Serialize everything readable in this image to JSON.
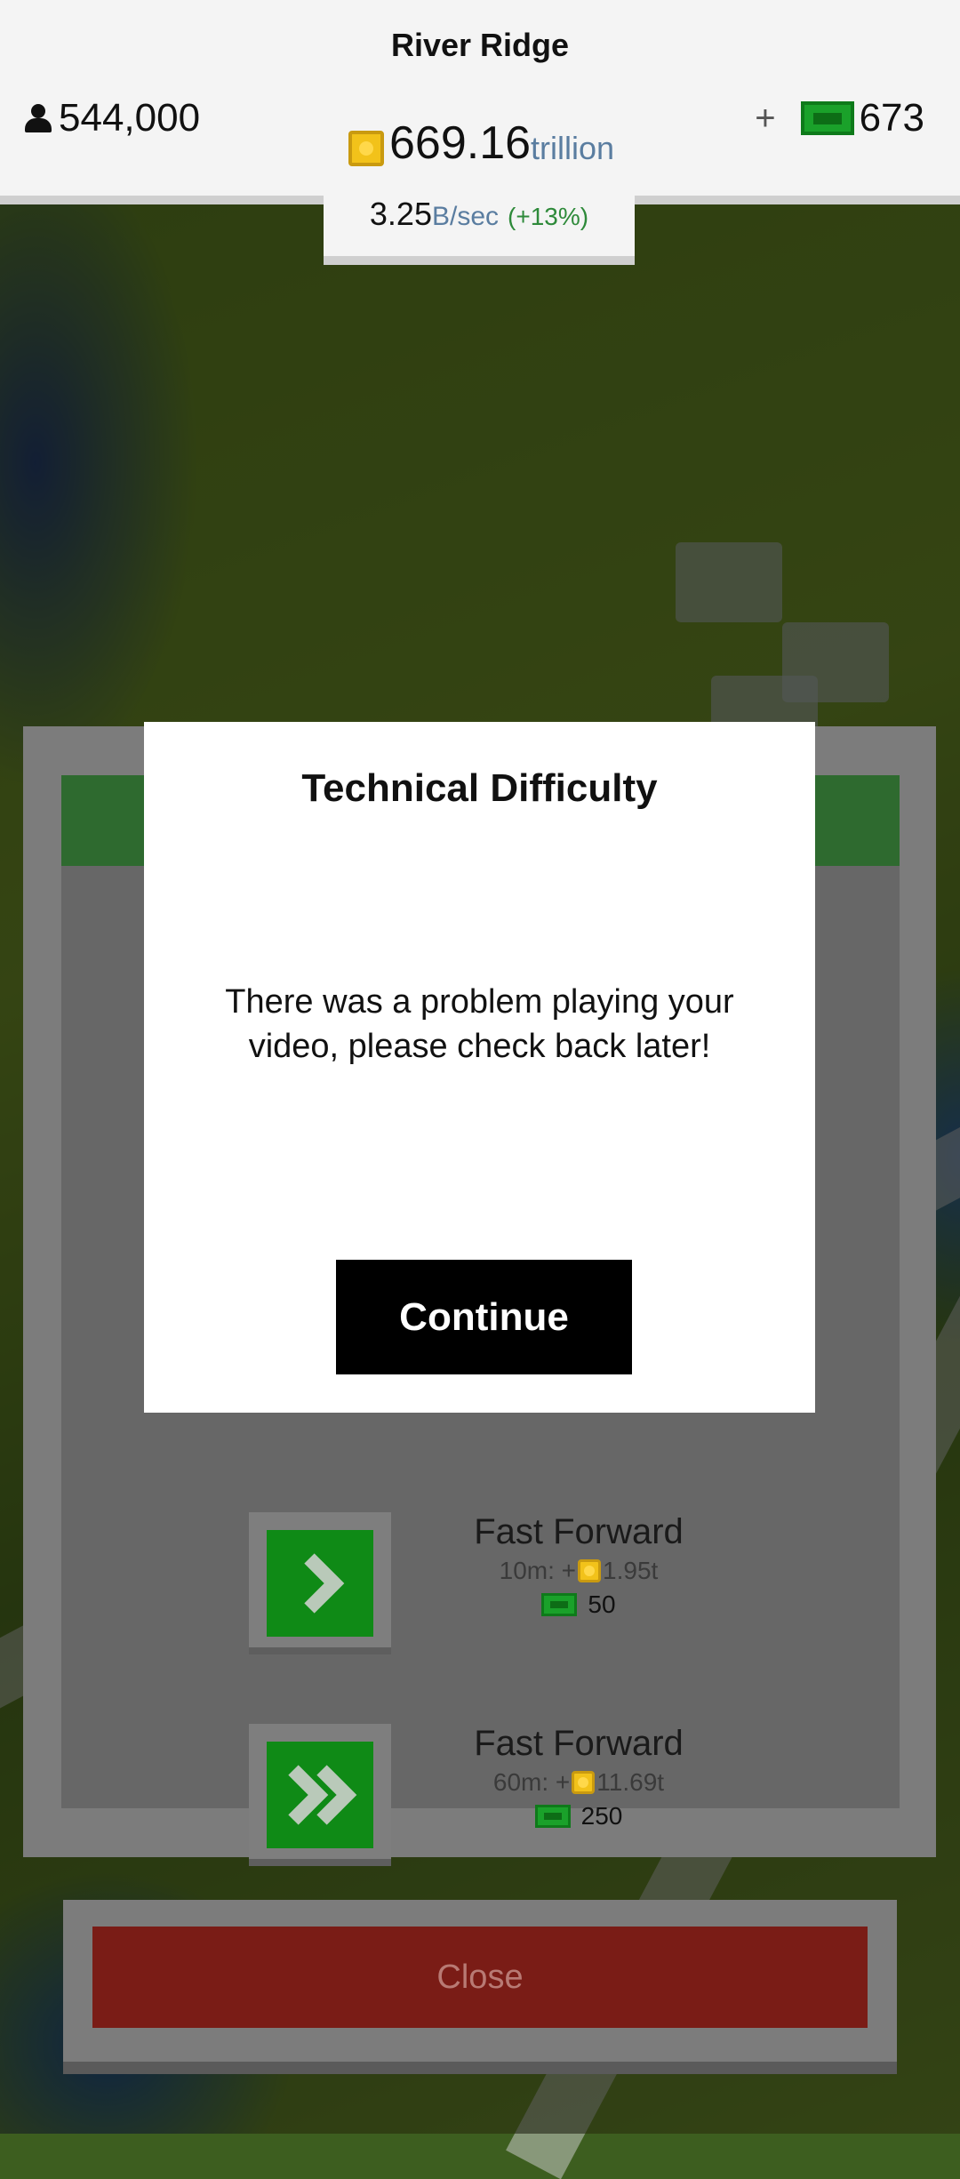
{
  "hud": {
    "city_name": "River Ridge",
    "population": "544,000",
    "money_amount": "669.16",
    "money_unit": "trillion",
    "rate_value": "3.25",
    "rate_unit": "B/sec",
    "rate_bonus": "(+13%)",
    "gems_plus": "+",
    "gems": "673",
    "icons": {
      "population": "person-icon",
      "money": "coin-icon",
      "gems": "cash-bill-icon"
    }
  },
  "panel": {
    "rows": [
      {
        "title": "Fast Forward",
        "duration": "10m: +",
        "reward": "1.95t",
        "cost": "50",
        "icon": "single-chevron-icon"
      },
      {
        "title": "Fast Forward",
        "duration": "60m: +",
        "reward": "11.69t",
        "cost": "250",
        "icon": "double-chevron-icon"
      }
    ],
    "close_label": "Close"
  },
  "dialog": {
    "title": "Technical Difficulty",
    "message": "There was a problem playing your video, please check back later!",
    "button_label": "Continue"
  },
  "colors": {
    "accent_green": "#0f8a16",
    "close_red": "#7a1c16",
    "header_green": "#2e6a2f"
  }
}
